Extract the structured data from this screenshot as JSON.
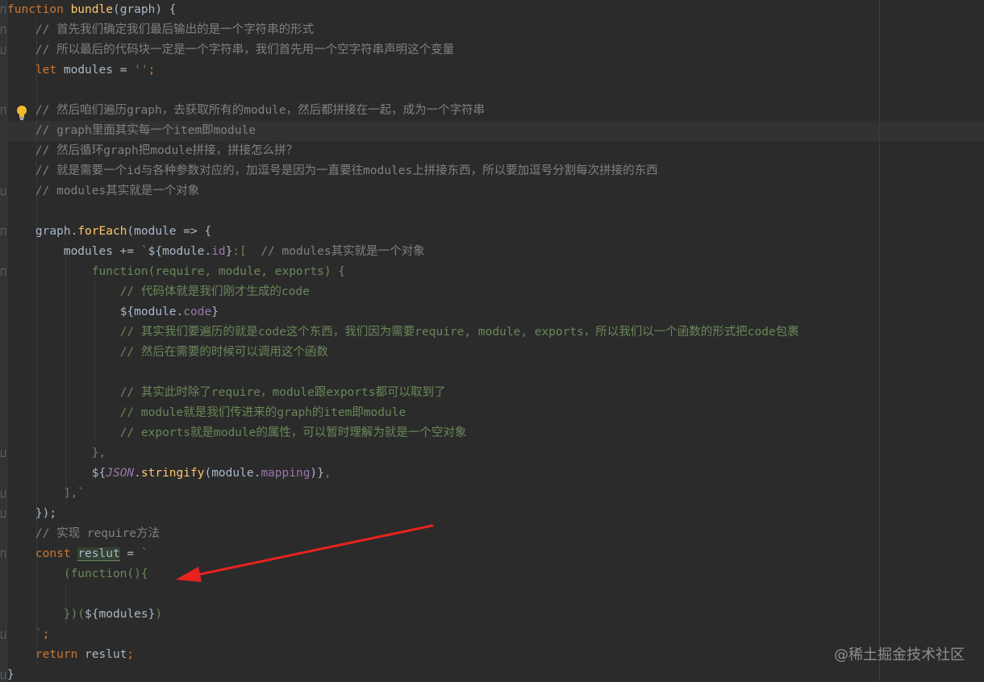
{
  "code": {
    "l1": {
      "kw": "function",
      "name": "bundle",
      "rest": "(graph) {"
    },
    "l2": "// 首先我们确定我们最后输出的是一个字符串的形式",
    "l3": "// 所以最后的代码块一定是一个字符串，我们首先用一个空字符串声明这个变量",
    "l4": {
      "kw": "let",
      "rest": " modules = ",
      "str": "''",
      "end": ";"
    },
    "l6": "// 然后咱们遍历graph，去获取所有的module，然后都拼接在一起，成为一个字符串",
    "l7": "// graph里面其实每一个item即module",
    "l8": "// 然后循环graph把module拼接，拼接怎么拼？",
    "l9": "// 就是需要一个id与各种参数对应的，加逗号是因为一直要往modules上拼接东西，所以要加逗号分割每次拼接的东西",
    "l10": "// modules其实就是一个对象",
    "l12": {
      "a": "graph.",
      "fn": "forEach",
      "b": "(module => {"
    },
    "l13": {
      "a": "modules += ",
      "str1": "`",
      "b": "${module.",
      "prop": "id",
      "c": "}",
      "str2": ":[  ",
      "cm": "// modules其实就是一个对象"
    },
    "l14": "function(require, module, exports) {",
    "l15": "// 代码体就是我们刚才生成的code",
    "l16": {
      "a": "${module.",
      "prop": "code",
      "b": "}"
    },
    "l17": "// 其实我们要遍历的就是code这个东西，我们因为需要require, module, exports，所以我们以一个函数的形式把code包裹",
    "l18": "// 然后在需要的时候可以调用这个函数",
    "l20": "// 其实此时除了require，module跟exports都可以取到了",
    "l21": "// module就是我们传进来的graph的item即module",
    "l22": "// exports就是module的属性，可以暂时理解为就是一个空对象",
    "l23": "},",
    "l24": {
      "a": "${",
      "it": "JSON",
      "b": ".",
      "fn": "stringify",
      "c": "(module.",
      "prop": "mapping",
      "d": ")}",
      "e": ","
    },
    "l25": "],`",
    "l26": "});",
    "l27": "// 实现 require方法",
    "l28": {
      "kw": "const",
      "var": "reslut",
      "rest": " = ",
      "str": "`"
    },
    "l29": "(function(){",
    "l31": {
      "a": "})(",
      "b": "${modules}",
      "c": ")"
    },
    "l32": {
      "str": "`",
      "end": ";"
    },
    "l33": {
      "kw": "return",
      "rest": " reslut",
      "end": ";"
    },
    "l34": "}"
  },
  "watermark": "@稀土掘金技术社区",
  "colors": {
    "background": "#2b2b2b",
    "keyword": "#cc7832",
    "function": "#ffc66d",
    "comment": "#808080",
    "string": "#6a8759",
    "property": "#9876aa",
    "text": "#a9b7c6",
    "arrow": "#e8231f"
  },
  "icons": [
    "lightbulb-icon",
    "fold-marker-icon",
    "annotation-arrow"
  ]
}
